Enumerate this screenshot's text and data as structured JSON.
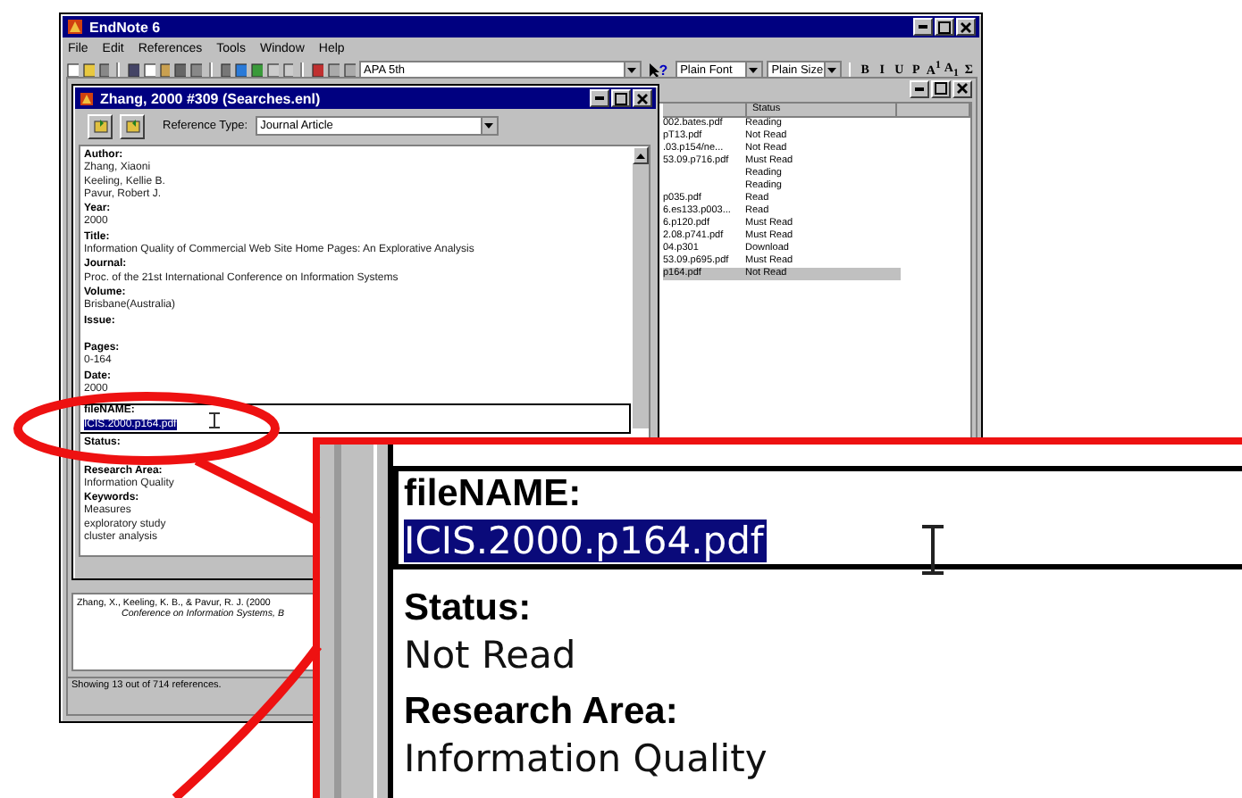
{
  "app_window": {
    "title": "EndNote 6"
  },
  "menu": [
    "File",
    "Edit",
    "References",
    "Tools",
    "Window",
    "Help"
  ],
  "toolbar": {
    "style": "APA 5th",
    "help_glyph": "?",
    "font": "Plain Font",
    "size": "Plain Size",
    "format_buttons": [
      "B",
      "I",
      "U",
      "P",
      "A$^{1}$",
      "A$_{1}$",
      "Σ"
    ]
  },
  "library": {
    "columns": [
      "Status"
    ],
    "rows": [
      {
        "file": "002.bates.pdf",
        "status": "Reading",
        "selected": false
      },
      {
        "file": "pT13.pdf",
        "status": "Not Read",
        "selected": false
      },
      {
        "file": ".03.p154/ne...",
        "status": "Not Read",
        "selected": false
      },
      {
        "file": "53.09.p716.pdf",
        "status": "Must Read",
        "selected": false
      },
      {
        "file": "",
        "status": "Reading",
        "selected": false
      },
      {
        "file": "",
        "status": "Reading",
        "selected": false
      },
      {
        "file": "p035.pdf",
        "status": "Read",
        "selected": false
      },
      {
        "file": "6.es133.p003...",
        "status": "Read",
        "selected": false
      },
      {
        "file": "6.p120.pdf",
        "status": "Must Read",
        "selected": false
      },
      {
        "file": "2.08.p741.pdf",
        "status": "Must Read",
        "selected": false
      },
      {
        "file": "04.p301",
        "status": "Download",
        "selected": false
      },
      {
        "file": "53.09.p695.pdf",
        "status": "Must Read",
        "selected": false
      },
      {
        "file": "p164.pdf",
        "status": "Not Read",
        "selected": true
      }
    ],
    "preview": [
      "Zhang, X., Keeling, K. B., & Pavur, R. J. (2000",
      "Conference on Information Systems, B"
    ],
    "status_bar": "Showing 13 out of 714 references."
  },
  "reference_window": {
    "title": "Zhang, 2000 #309  (Searches.enl)",
    "type_label": "Reference Type:",
    "type": "Journal Article",
    "fields": [
      {
        "label": "Author:",
        "lines": [
          "Zhang, Xiaoni",
          "Keeling, Kellie B.",
          "Pavur, Robert J."
        ],
        "selected": false
      },
      {
        "label": "Year:",
        "lines": [
          "2000"
        ],
        "selected": false
      },
      {
        "label": "Title:",
        "lines": [
          "Information Quality of Commercial Web Site Home Pages: An Explorative Analysis"
        ],
        "selected": false
      },
      {
        "label": "Journal:",
        "lines": [
          "Proc. of the 21st International Conference on Information Systems"
        ],
        "selected": false
      },
      {
        "label": "Volume:",
        "lines": [
          "Brisbane(Australia)"
        ],
        "selected": false
      },
      {
        "label": "Issue:",
        "selected": false
      },
      {
        "label": "Pages:",
        "lines": [
          "0-164"
        ],
        "selected": false
      },
      {
        "label": "Date:",
        "lines": [
          "2000"
        ],
        "selected": false
      },
      {
        "label": "fileNAME:",
        "lines": [
          "ICIS.2000.p164.pdf"
        ],
        "selected": true
      },
      {
        "label": "Status:",
        "selected": false
      },
      {
        "label": "Research Area:",
        "lines": [
          "Information Quality"
        ],
        "selected": false
      },
      {
        "label": "Keywords:",
        "lines": [
          "Measures",
          "exploratory study",
          "cluster analysis"
        ],
        "selected": false
      }
    ]
  },
  "callout": {
    "fields": [
      {
        "label": "fileNAME:",
        "lines": [
          "ICIS.2000.p164.pdf"
        ],
        "selected": true
      },
      {
        "label": "Status:",
        "lines": [
          "Not Read"
        ],
        "selected": false
      },
      {
        "label": "Research Area:",
        "lines": [
          "Information Quality"
        ],
        "selected": false
      }
    ]
  }
}
